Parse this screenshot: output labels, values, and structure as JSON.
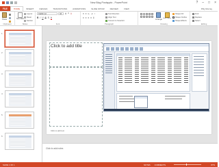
{
  "window": {
    "title": "New Blog Postspptx - PowerPoint"
  },
  "tabs": [
    {
      "label": "FILE"
    },
    {
      "label": "HOME"
    },
    {
      "label": "INSERT"
    },
    {
      "label": "DESIGN"
    },
    {
      "label": "TRANSITIONS"
    },
    {
      "label": "ANIMATIONS"
    },
    {
      "label": "SLIDE SHOW"
    },
    {
      "label": "REVIEW"
    },
    {
      "label": "VIEW"
    }
  ],
  "active_tab_index": 1,
  "user": "Pilly Murray",
  "ribbon": {
    "groups": {
      "clipboard": "Clipboard",
      "slides": "Slides",
      "font": "Font",
      "paragraph": "Paragraph",
      "drawing": "Drawing",
      "editing": "Editing"
    },
    "paste": "Paste",
    "new_slide": "New Slide",
    "layout": "Layout",
    "reset": "Reset",
    "section": "Section",
    "font_name": "Calibri (H",
    "font_size": "44",
    "text_direction": "Text Direction",
    "align_text": "Align Text",
    "convert_smartart": "Convert to SmartArt",
    "arrange": "Arrange",
    "quick_styles": "Quick Styles",
    "shape_fill": "Shape Fill",
    "shape_outline": "Shape Outline",
    "shape_effects": "Shape Effects",
    "find": "Find",
    "replace": "Replace",
    "select": "Select"
  },
  "thumbnails": [
    {
      "number": "1"
    },
    {
      "number": "2"
    },
    {
      "number": "3"
    },
    {
      "number": "4"
    },
    {
      "number": "5"
    },
    {
      "number": "6"
    }
  ],
  "slide": {
    "title_placeholder": "Click to add title",
    "caption": "Click to add text"
  },
  "notes": {
    "placeholder": "Click to add notes"
  },
  "statusbar": {
    "slide_info": "SLIDE 1 OF 1",
    "notes": "NOTES",
    "comments": "COMMENTS",
    "zoom": "87%"
  },
  "colors": {
    "accent": "#d24726"
  },
  "icons": [
    "paste-icon",
    "new-slide-icon",
    "find-icon",
    "replace-icon",
    "select-icon",
    "arrange-icon",
    "quick-styles-icon"
  ]
}
